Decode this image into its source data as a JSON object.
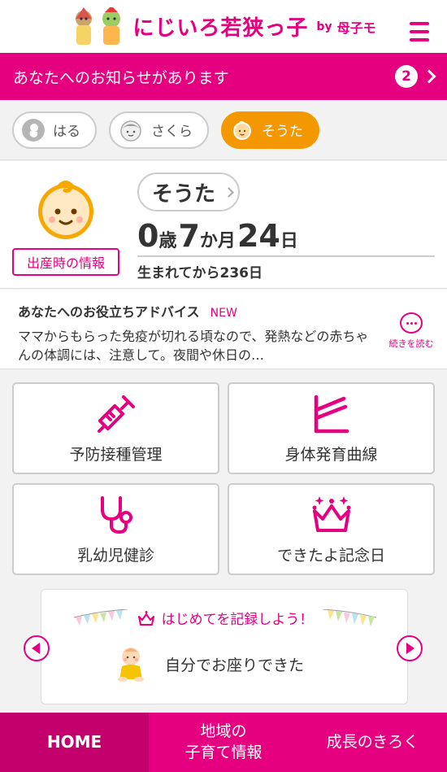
{
  "header": {
    "logo_text": "にじいろ若狭っ子",
    "logo_by": "by",
    "logo_sub": "母子モ"
  },
  "notice": {
    "text": "あなたへのお知らせがあります",
    "count": "2"
  },
  "children": [
    {
      "name": "はる",
      "active": false
    },
    {
      "name": "さくら",
      "active": false
    },
    {
      "name": "そうた",
      "active": true
    }
  ],
  "profile": {
    "name": "そうた",
    "birth_button": "出産時の情報",
    "age_years": "0",
    "age_years_unit": "歳",
    "age_months": "7",
    "age_months_unit": "か月",
    "age_days": "24",
    "age_days_unit": "日",
    "since_birth": "生まれてから236日"
  },
  "advice": {
    "title": "あなたへのお役立ちアドバイス",
    "new_label": "NEW",
    "body": "ママからもらった免疫が切れる頃なので、発熱などの赤ちゃんの体調には、注意して。夜間や休日の…",
    "read_more": "続きを読む"
  },
  "menu": [
    {
      "label": "予防接種管理",
      "icon": "syringe-icon"
    },
    {
      "label": "身体発育曲線",
      "icon": "growth-chart-icon"
    },
    {
      "label": "乳幼児健診",
      "icon": "stethoscope-icon"
    },
    {
      "label": "できたよ記念日",
      "icon": "crown-icon"
    }
  ],
  "milestone": {
    "heading": "はじめてを記録しよう！",
    "item": "自分でお座りできた"
  },
  "bottom_nav": {
    "home": "HOME",
    "local_info_line1": "地域の",
    "local_info_line2": "子育て情報",
    "growth": "成長のきろく"
  },
  "colors": {
    "brand": "#e4007f",
    "active_child": "#f39800",
    "home_tab": "#c4006d"
  }
}
